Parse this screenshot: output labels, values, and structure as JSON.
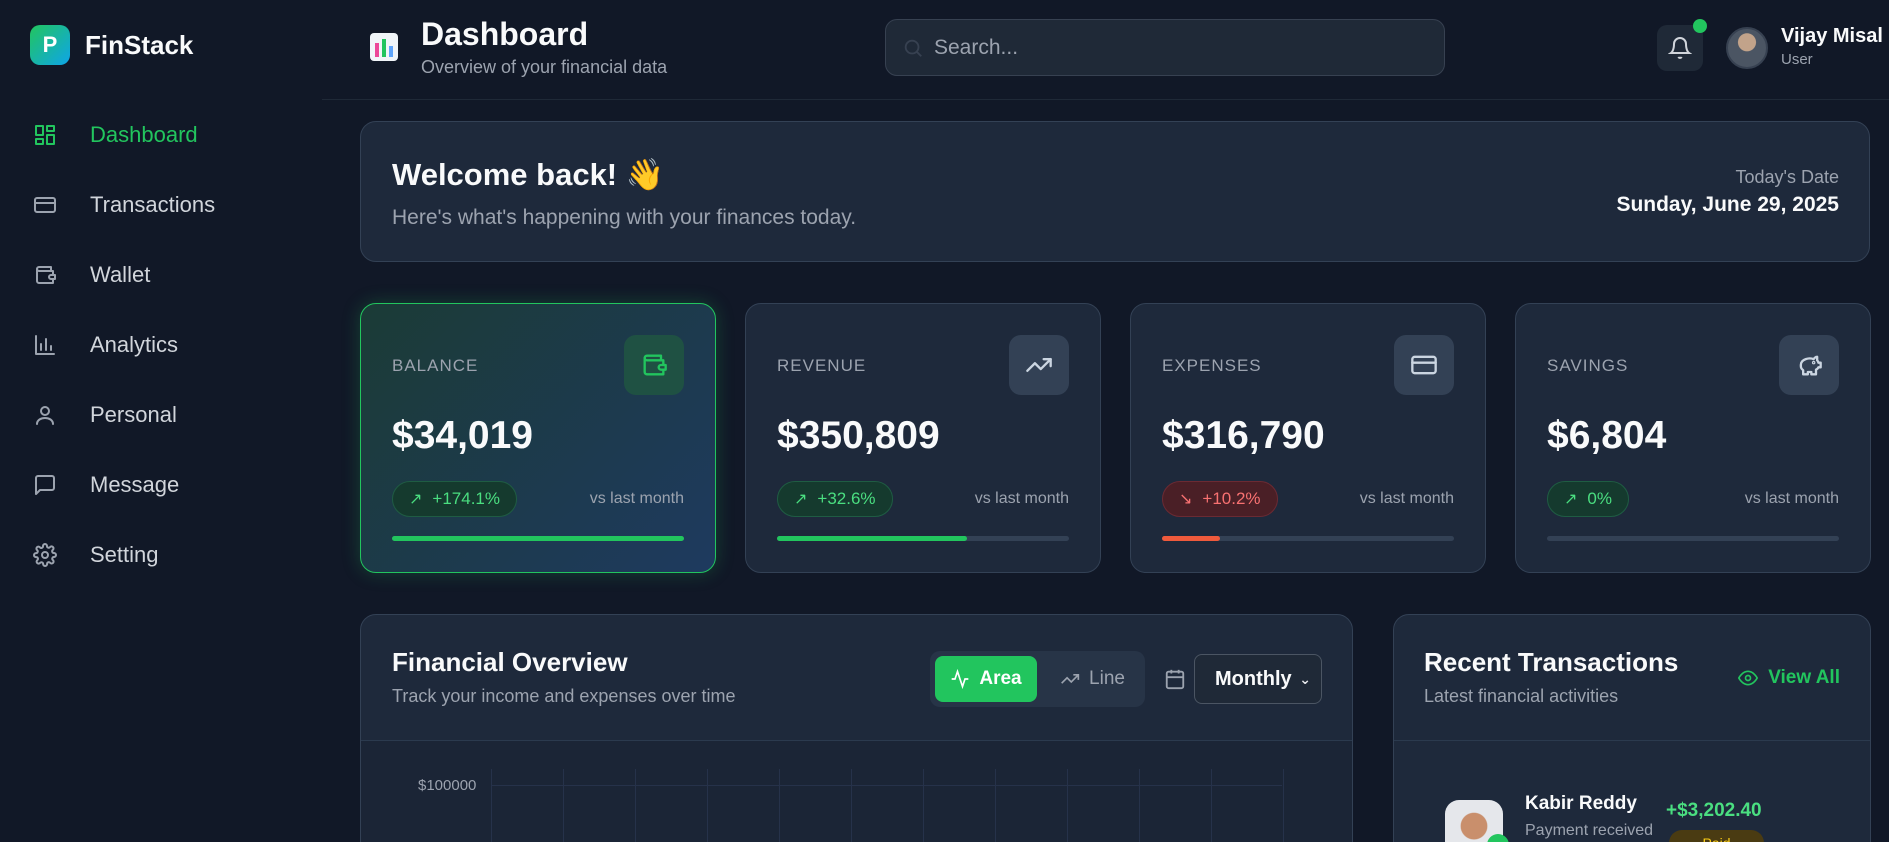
{
  "brand": {
    "logo_letter": "P",
    "name": "FinStack"
  },
  "sidebar": {
    "items": [
      {
        "label": "Dashboard",
        "icon": "grid-icon",
        "active": true
      },
      {
        "label": "Transactions",
        "icon": "card-icon",
        "active": false
      },
      {
        "label": "Wallet",
        "icon": "wallet-icon",
        "active": false
      },
      {
        "label": "Analytics",
        "icon": "bar-chart-icon",
        "active": false
      },
      {
        "label": "Personal",
        "icon": "user-icon",
        "active": false
      },
      {
        "label": "Message",
        "icon": "message-icon",
        "active": false
      },
      {
        "label": "Setting",
        "icon": "gear-icon",
        "active": false
      }
    ]
  },
  "header": {
    "title": "Dashboard",
    "subtitle": "Overview of your financial data",
    "search_placeholder": "Search...",
    "user_name": "Vijay Misal",
    "user_role": "User"
  },
  "welcome": {
    "title": "Welcome back! 👋",
    "subtitle": "Here's what's happening with your finances today.",
    "date_label": "Today's Date",
    "date_value": "Sunday, June 29, 2025"
  },
  "stats": [
    {
      "label": "BALANCE",
      "value": "$34,019",
      "change": "+174.1%",
      "direction": "up",
      "vs": "vs last month",
      "progress": 1.0,
      "bar_color": "#22c55e"
    },
    {
      "label": "REVENUE",
      "value": "$350,809",
      "change": "+32.6%",
      "direction": "up",
      "vs": "vs last month",
      "progress": 0.65,
      "bar_color": "#22c55e"
    },
    {
      "label": "EXPENSES",
      "value": "$316,790",
      "change": "+10.2%",
      "direction": "down",
      "vs": "vs last month",
      "progress": 0.2,
      "bar_color": "#ef5a3c"
    },
    {
      "label": "SAVINGS",
      "value": "$6,804",
      "change": "0%",
      "direction": "up",
      "vs": "vs last month",
      "progress": 0,
      "bar_color": "#22c55e"
    }
  ],
  "overview": {
    "title": "Financial Overview",
    "subtitle": "Track your income and expenses over time",
    "toggle_area": "Area",
    "toggle_line": "Line",
    "period": "Monthly",
    "y_tick_top": "$100000"
  },
  "recent": {
    "title": "Recent Transactions",
    "subtitle": "Latest financial activities",
    "view_all": "View All",
    "transactions": [
      {
        "name": "Kabir Reddy",
        "description": "Payment received",
        "amount": "+$3,202.40",
        "status": "Paid"
      }
    ]
  },
  "colors": {
    "accent": "#22c55e",
    "danger": "#ef4444",
    "background": "#111827",
    "card": "#1e293b"
  }
}
